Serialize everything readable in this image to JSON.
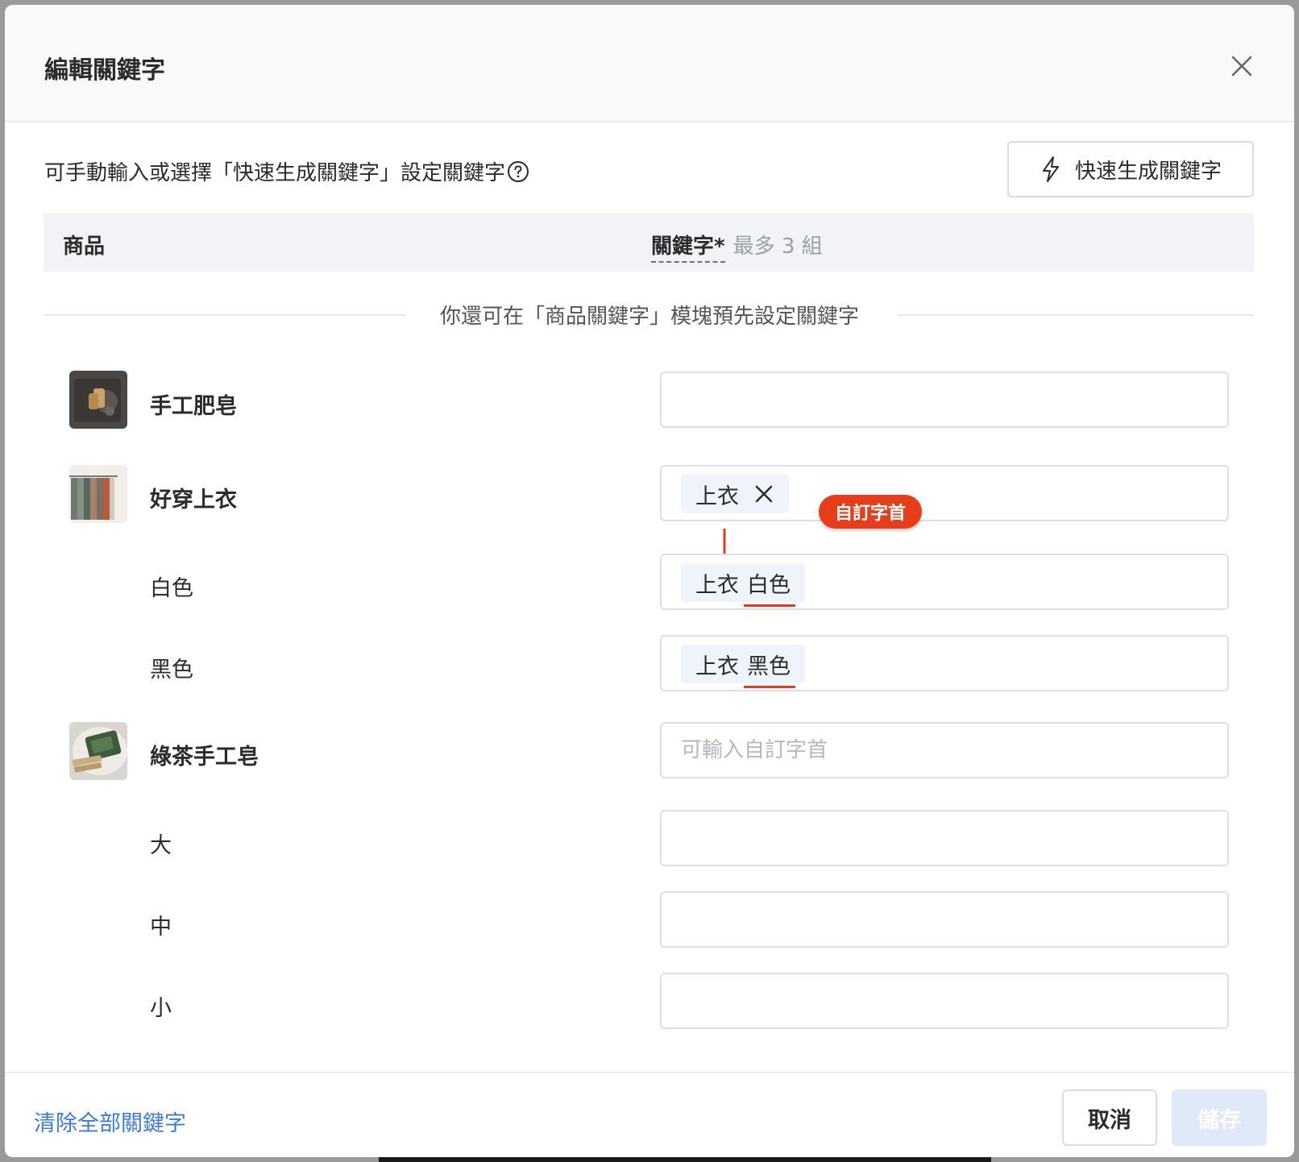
{
  "dialog": {
    "title": "編輯關鍵字"
  },
  "intro_text": "可手動輸入或選擇「快速生成關鍵字」設定關鍵字",
  "quick_generate_label": "快速生成關鍵字",
  "table_header": {
    "product": "商品",
    "keyword": "關鍵字*",
    "keyword_hint": "最多 3 組"
  },
  "divider_text": "你還可在「商品關鍵字」模塊預先設定關鍵字",
  "rows": [
    {
      "label": "手工肥皂",
      "thumb_icon": "soap-thumbnail",
      "keyword_value": ""
    },
    {
      "label": "好穿上衣",
      "thumb_icon": "shirts-thumbnail",
      "prefix_tag": "上衣",
      "badge": "自訂字首"
    },
    {
      "label": "白色",
      "tag_prefix": "上衣",
      "tag_variant": "白色"
    },
    {
      "label": "黑色",
      "tag_prefix": "上衣",
      "tag_variant": "黑色"
    },
    {
      "label": "綠茶手工皂",
      "thumb_icon": "green-tea-soap-thumbnail",
      "placeholder": "可輸入自訂字首"
    },
    {
      "label": "大",
      "keyword_value": ""
    },
    {
      "label": "中",
      "keyword_value": ""
    },
    {
      "label": "小",
      "keyword_value": ""
    }
  ],
  "footer": {
    "clear_all": "清除全部關鍵字",
    "cancel": "取消",
    "save": "儲存"
  },
  "colors": {
    "accent_red": "#e63d1b",
    "link_blue": "#3d7bd9",
    "tag_bg": "#eef4fa",
    "save_disabled_bg": "#dfe9f8"
  }
}
